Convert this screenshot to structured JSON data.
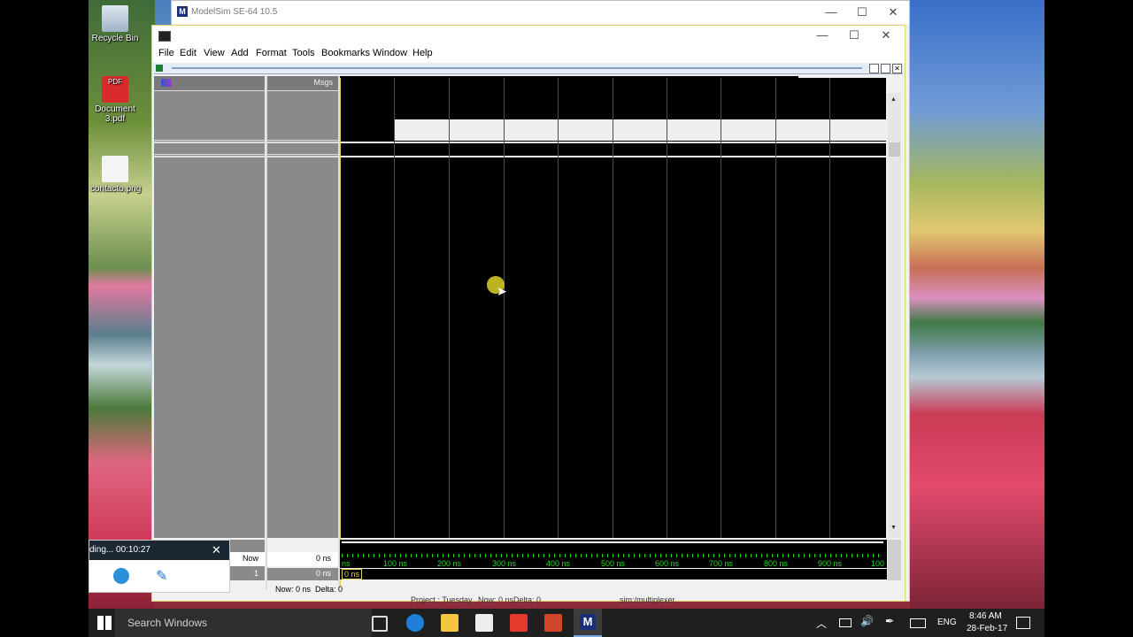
{
  "desktop": {
    "icons": [
      {
        "label": "Recycle Bin"
      },
      {
        "label": "Document 3.pdf"
      },
      {
        "label": "contacto.png"
      }
    ]
  },
  "outer_window": {
    "title": "ModelSim SE-64 10.5",
    "controls": {
      "minimize": "—",
      "maximize": "☐",
      "close": "✕"
    }
  },
  "inner_window": {
    "controls": {
      "minimize": "—",
      "maximize": "☐",
      "close": "✕"
    },
    "menu": [
      "File",
      "Edit",
      "View",
      "Add",
      "Format",
      "Tools",
      "Bookmarks",
      "Window",
      "Help"
    ]
  },
  "wave": {
    "msgs_header": "Msgs",
    "now_label": "Now",
    "now_value": "0 ns",
    "cursor_label": "1",
    "cursor_value": "0 ns",
    "cursor_tag": "0 ns",
    "ruler_ticks": [
      "ns",
      "100 ns",
      "200 ns",
      "300 ns",
      "400 ns",
      "500 ns",
      "600 ns",
      "700 ns",
      "800 ns",
      "900 ns",
      "100"
    ],
    "status_now": "Now: 0 ns",
    "status_delta": "Delta: 0"
  },
  "status_bar": {
    "project": "Project : Tuesday",
    "now": "Now: 0 ns",
    "delta": "Delta: 0",
    "sim": "sim:/multiplexer"
  },
  "recorder": {
    "status_text": "ding... 00:10:27",
    "close": "✕"
  },
  "taskbar": {
    "search_placeholder": "Search Windows",
    "lang": "ENG",
    "time": "8:46 AM",
    "date": "28-Feb-17"
  }
}
